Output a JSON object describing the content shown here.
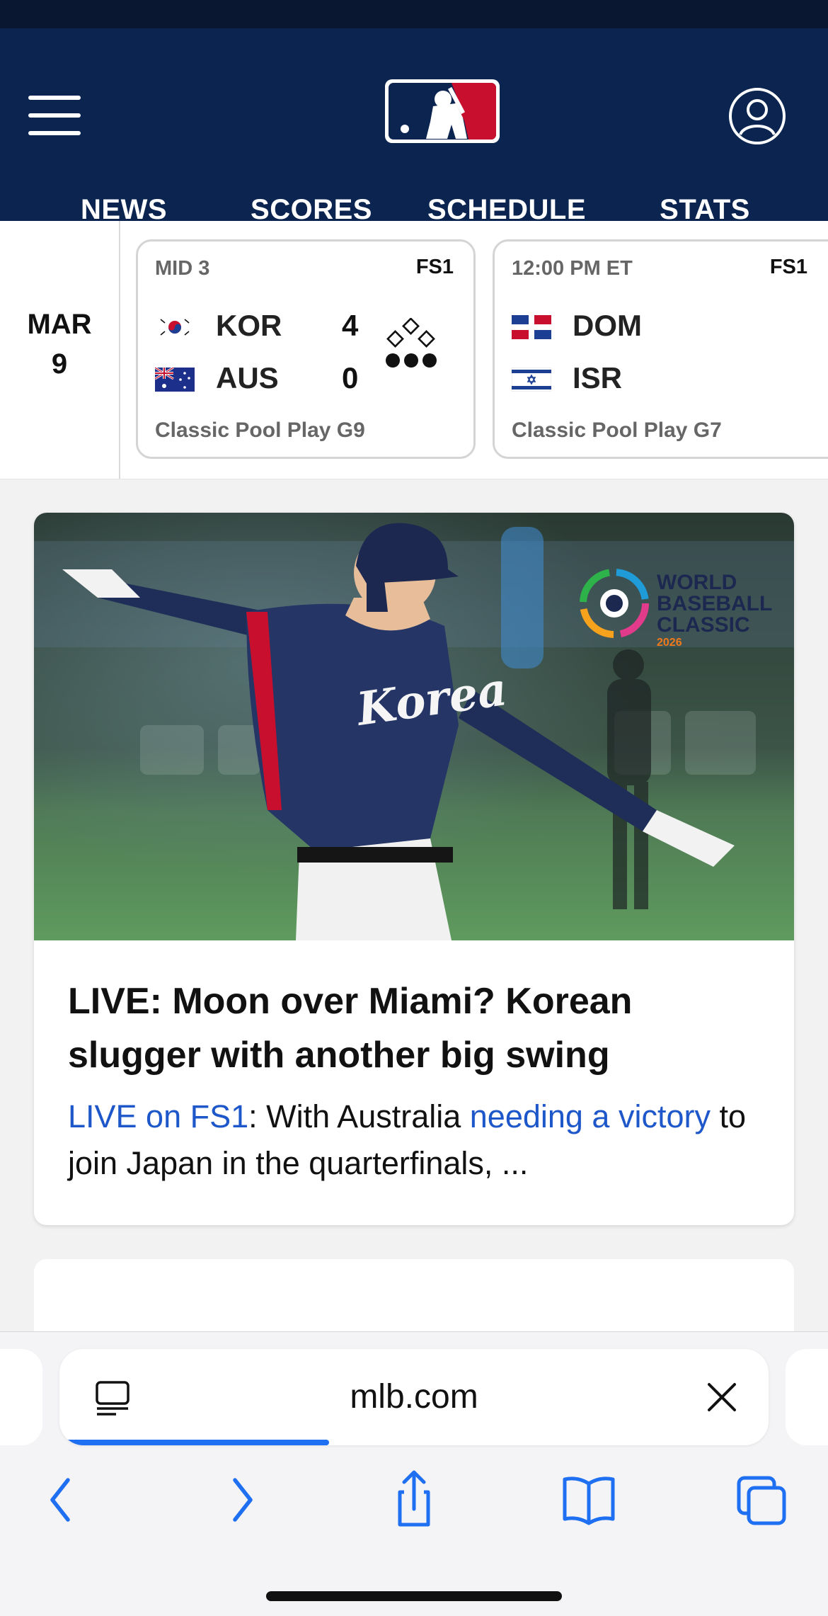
{
  "header": {
    "menu_icon": "hamburger-menu-icon",
    "logo_icon": "mlb-batter-logo",
    "account_icon": "user-account-icon",
    "nav": [
      {
        "label": "NEWS"
      },
      {
        "label": "SCORES"
      },
      {
        "label": "SCHEDULE"
      },
      {
        "label": "STATS"
      }
    ],
    "brand_colors": {
      "navy": "#0b2450",
      "red": "#c8102e",
      "blue": "#1d57c9"
    }
  },
  "scoreboard": {
    "date_month": "MAR",
    "date_day": "9",
    "games": [
      {
        "status": "MID 3",
        "network": "FS1",
        "away": {
          "abbr": "KOR",
          "score": "4",
          "flag": "south-korea-flag-icon"
        },
        "home": {
          "abbr": "AUS",
          "score": "0",
          "flag": "australia-flag-icon"
        },
        "bases_icon": "base-runners-diamond-icon",
        "outs": 3,
        "description": "Classic Pool Play G9"
      },
      {
        "status": "12:00 PM ET",
        "network": "FS1",
        "away": {
          "abbr": "DOM",
          "flag": "dominican-republic-flag-icon"
        },
        "home": {
          "abbr": "ISR",
          "flag": "israel-flag-icon"
        },
        "description": "Classic Pool Play G7"
      }
    ]
  },
  "story": {
    "image": {
      "logo_lines": [
        "WORLD",
        "BASEBALL",
        "CLASSIC"
      ],
      "logo_year": "2026",
      "jersey_text": "Korea"
    },
    "headline": "LIVE: Moon over Miami? Korean slugger with another big swing",
    "summary": {
      "link_1": "LIVE on FS1",
      "text_1": ": With Australia ",
      "link_2": "needing a victory",
      "text_2": " to join Japan in the quarterfinals, ..."
    }
  },
  "browser": {
    "url": "mlb.com",
    "reader_icon": "reader-mode-icon",
    "clear_icon": "close-x-icon",
    "load_progress": 0.38,
    "toolbar": [
      {
        "icon": "back-chevron-icon"
      },
      {
        "icon": "forward-chevron-icon"
      },
      {
        "icon": "share-icon"
      },
      {
        "icon": "bookmarks-book-icon"
      },
      {
        "icon": "tabs-icon"
      }
    ]
  }
}
